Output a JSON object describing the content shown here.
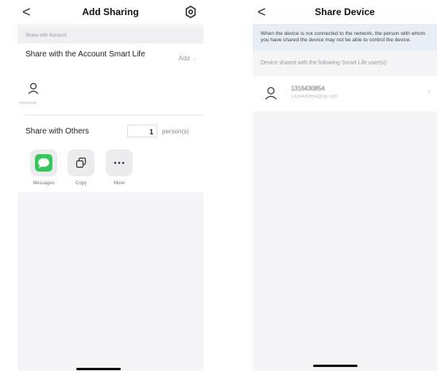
{
  "left": {
    "nav": {
      "back": "<",
      "title": "Add Sharing"
    },
    "section_label": "Share with Account",
    "share_account": {
      "title": "Share with the Account Smart Life",
      "add_label": "Add"
    },
    "user": {
      "name": "nimezoea"
    },
    "share_others": {
      "label": "Share with Others",
      "count": "1",
      "unit": "person(s)"
    },
    "share_options": [
      {
        "label": "Messages",
        "icon": "messages-icon",
        "color": "#34c759"
      },
      {
        "label": "Copy",
        "icon": "copy-icon"
      },
      {
        "label": "More",
        "icon": "more-icon"
      }
    ]
  },
  "right": {
    "nav": {
      "back": "<",
      "title": "Share Device"
    },
    "notice": "When the device is not connected to the network, the person with whom you have shared the device may not be able to control the device.",
    "shared_label": "Device shared with the following Smart Life user(s):",
    "shared_user": {
      "id": "1316430854",
      "email": "1316430854@qq.com"
    }
  },
  "colors": {
    "banner": "#e9edf6",
    "background": "#f5f5f7",
    "accent": "#34c759"
  }
}
